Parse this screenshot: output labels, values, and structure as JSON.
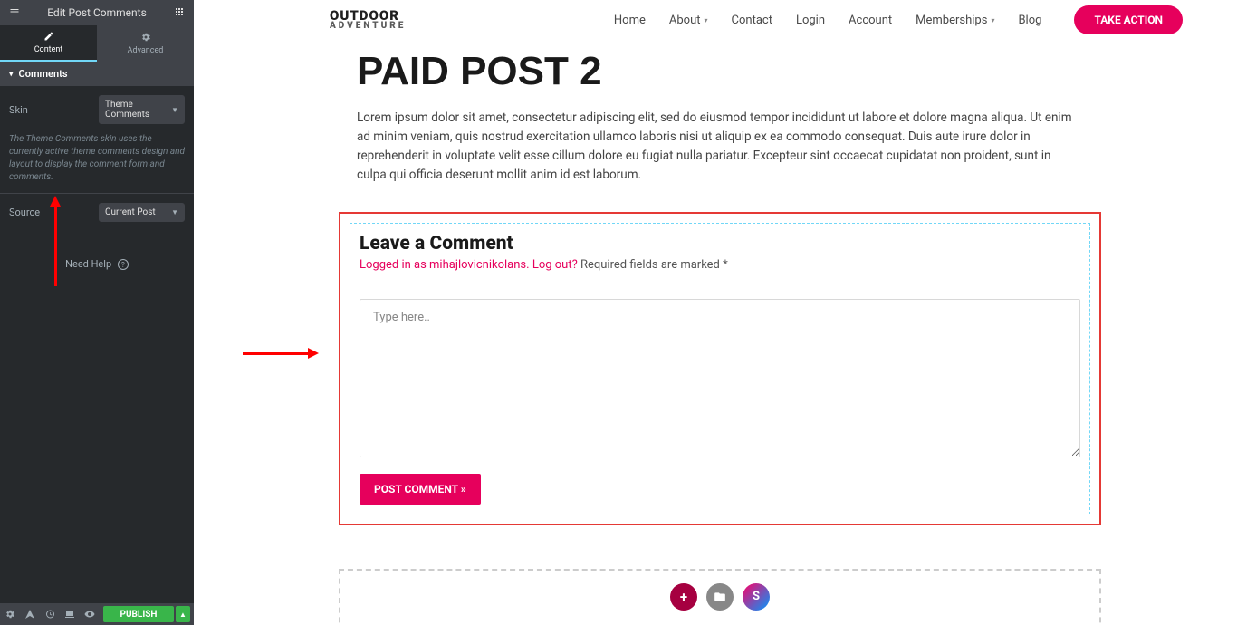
{
  "sidebar": {
    "title": "Edit Post Comments",
    "tabs": {
      "content": "Content",
      "advanced": "Advanced"
    },
    "section": "Comments",
    "skin_label": "Skin",
    "skin_value": "Theme Comments",
    "skin_hint": "The Theme Comments skin uses the currently active theme comments design and layout to display the comment form and comments.",
    "source_label": "Source",
    "source_value": "Current Post",
    "need_help": "Need Help",
    "publish": "PUBLISH"
  },
  "site": {
    "logo_line1": "OUTDOOR",
    "logo_line2": "ADVENTURE",
    "nav": {
      "home": "Home",
      "about": "About",
      "contact": "Contact",
      "login": "Login",
      "account": "Account",
      "memberships": "Memberships",
      "blog": "Blog",
      "cta": "TAKE ACTION"
    }
  },
  "post": {
    "title": "PAID POST 2",
    "body": "Lorem ipsum dolor sit amet, consectetur adipiscing elit, sed do eiusmod tempor incididunt ut labore et dolore magna aliqua. Ut enim ad minim veniam, quis nostrud exercitation ullamco laboris nisi ut aliquip ex ea commodo consequat. Duis aute irure dolor in reprehenderit in voluptate velit esse cillum dolore eu fugiat nulla pariatur. Excepteur sint occaecat cupidatat non proident, sunt in culpa qui officia deserunt mollit anim id est laborum."
  },
  "comments": {
    "heading": "Leave a Comment",
    "logged_in": "Logged in as mihajlovicnikolans",
    "logout": "Log out?",
    "required": "Required fields are marked *",
    "placeholder": "Type here..",
    "submit": "POST COMMENT »"
  },
  "icons": {
    "add": "+",
    "folder": "📁",
    "s": "S"
  }
}
